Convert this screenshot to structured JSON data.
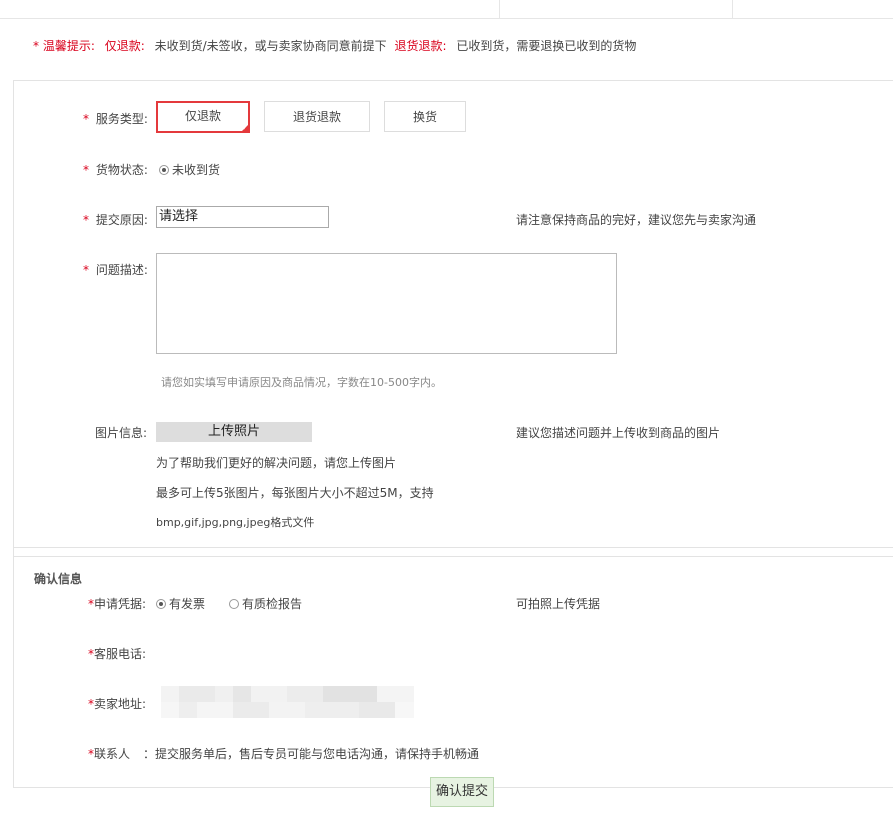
{
  "notice": {
    "prefix": "温馨提示:",
    "refund_only_label": "仅退款:",
    "refund_only_text": "未收到货/未签收，或与卖家协商同意前提下",
    "return_refund_label": "退货退款:",
    "return_refund_text": "已收到货，需要退换已收到的货物"
  },
  "service_type": {
    "label": "服务类型:",
    "options": [
      "仅退款",
      "退货退款",
      "换货"
    ],
    "selected": "仅退款"
  },
  "goods_status": {
    "label": "货物状态:",
    "option": "未收到货"
  },
  "reason": {
    "label": "提交原因:",
    "value": "请选择",
    "hint": "请注意保持商品的完好，建议您先与卖家沟通"
  },
  "description": {
    "label": "问题描述:",
    "value": "",
    "hint": "请您如实填写申请原因及商品情况，字数在10-500字内。"
  },
  "image_info": {
    "label": "图片信息:",
    "upload_button": "上传照片",
    "hint": "建议您描述问题并上传收到商品的图片",
    "note1": "为了帮助我们更好的解决问题，请您上传图片",
    "note2": "最多可上传5张图片，每张图片大小不超过5M，支持",
    "note3": "bmp,gif,jpg,png,jpeg格式文件"
  },
  "confirm": {
    "title": "确认信息",
    "evidence_label": "申请凭据:",
    "evidence_options": [
      "有发票",
      "有质检报告"
    ],
    "evidence_hint": "可拍照上传凭据",
    "phone_label": "客服电话:",
    "address_label": "卖家地址:",
    "contact_label": "联系人",
    "contact_text": "：提交服务单后，售后专员可能与您电话沟通，请保持手机畅通"
  },
  "submit_label": "确认提交",
  "colors": {
    "accent_red": "#e4393c",
    "notice_red": "#d9001b",
    "submit_bg": "#e7f3e2"
  },
  "icons": {
    "required": "asterisk",
    "selected_corner": "check-corner-icon"
  }
}
